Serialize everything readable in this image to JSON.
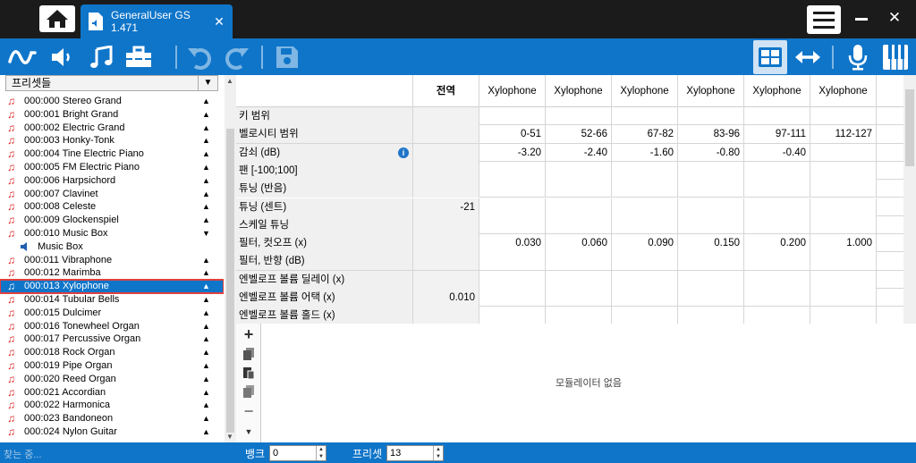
{
  "titlebar": {
    "tab_title": "GeneralUser GS 1.471",
    "tab_close": "✕",
    "close_glyph": "✕"
  },
  "toolbar": {
    "icons": [
      "waveform-icon",
      "speaker-icon",
      "music-note-icon",
      "toolbox-icon",
      "undo-icon",
      "redo-icon",
      "save-icon",
      "grid-view-icon",
      "arrows-horizontal-icon",
      "microphone-icon",
      "piano-keys-icon"
    ]
  },
  "preset_panel": {
    "dropdown_label": "프리셋들",
    "presets": [
      {
        "label": "000:000 Stereo Grand"
      },
      {
        "label": "000:001 Bright Grand"
      },
      {
        "label": "000:002 Electric Grand"
      },
      {
        "label": "000:003 Honky-Tonk"
      },
      {
        "label": "000:004 Tine Electric Piano"
      },
      {
        "label": "000:005 FM Electric Piano"
      },
      {
        "label": "000:006 Harpsichord"
      },
      {
        "label": "000:007 Clavinet"
      },
      {
        "label": "000:008 Celeste"
      },
      {
        "label": "000:009 Glockenspiel"
      },
      {
        "label": "000:010 Music Box",
        "expanded": true
      },
      {
        "label": "Music Box",
        "child": true
      },
      {
        "label": "000:011 Vibraphone"
      },
      {
        "label": "000:012 Marimba"
      },
      {
        "label": "000:013 Xylophone",
        "selected": true
      },
      {
        "label": "000:014 Tubular Bells"
      },
      {
        "label": "000:015 Dulcimer"
      },
      {
        "label": "000:016 Tonewheel Organ"
      },
      {
        "label": "000:017 Percussive Organ"
      },
      {
        "label": "000:018 Rock Organ"
      },
      {
        "label": "000:019 Pipe Organ"
      },
      {
        "label": "000:020 Reed Organ"
      },
      {
        "label": "000:021 Accordian"
      },
      {
        "label": "000:022 Harmonica"
      },
      {
        "label": "000:023 Bandoneon"
      },
      {
        "label": "000:024 Nylon Guitar"
      }
    ]
  },
  "grid": {
    "columns": [
      "전역",
      "Xylophone",
      "Xylophone",
      "Xylophone",
      "Xylophone",
      "Xylophone",
      "Xylophone"
    ],
    "rows": [
      {
        "name": "키 범위",
        "cells": [
          "",
          "",
          "",
          "",
          "",
          "",
          ""
        ]
      },
      {
        "name": "벨로시티 범위",
        "cells": [
          "",
          "0-51",
          "52-66",
          "67-82",
          "83-96",
          "97-111",
          "112-127"
        ]
      },
      {
        "name": "감쇠 (dB)",
        "info": true,
        "cells": [
          "",
          "-3.20",
          "-2.40",
          "-1.60",
          "-0.80",
          "-0.40",
          ""
        ]
      },
      {
        "name": "팬 [-100;100]",
        "cells": [
          "",
          "",
          "",
          "",
          "",
          "",
          ""
        ]
      },
      {
        "name": "튜닝 (반음)",
        "cells": [
          "",
          "",
          "",
          "",
          "",
          "",
          ""
        ]
      },
      {
        "name": "튜닝 (센트)",
        "cells": [
          "-21",
          "",
          "",
          "",
          "",
          "",
          ""
        ]
      },
      {
        "name": "스케일 튜닝",
        "cells": [
          "",
          "",
          "",
          "",
          "",
          "",
          ""
        ]
      },
      {
        "name": "필터, 컷오프 (x)",
        "cells": [
          "",
          "0.030",
          "0.060",
          "0.090",
          "0.150",
          "0.200",
          "1.000"
        ]
      },
      {
        "name": "필터, 반향 (dB)",
        "cells": [
          "",
          "",
          "",
          "",
          "",
          "",
          ""
        ]
      },
      {
        "name": "엔벨로프 볼륨 딜레이 (x)",
        "cells": [
          "",
          "",
          "",
          "",
          "",
          "",
          ""
        ]
      },
      {
        "name": "엔벨로프 볼륨 어택 (x)",
        "cells": [
          "0.010",
          "",
          "",
          "",
          "",
          "",
          ""
        ]
      },
      {
        "name": "엔벨로프 볼륨 홀드 (x)",
        "cells": [
          "",
          "",
          "",
          "",
          "",
          "",
          ""
        ]
      }
    ]
  },
  "modulators": {
    "empty_text": "모듈레이터 없음"
  },
  "statusbar": {
    "search_placeholder": "찾는 중...",
    "bank_label": "뱅크",
    "bank_value": "0",
    "preset_label": "프리셋",
    "preset_value": "13"
  },
  "colors": {
    "accent": "#0f75c9",
    "titlebar": "#1b1b1b",
    "selection_outline": "#e04040",
    "note_icon": "#d22222"
  }
}
